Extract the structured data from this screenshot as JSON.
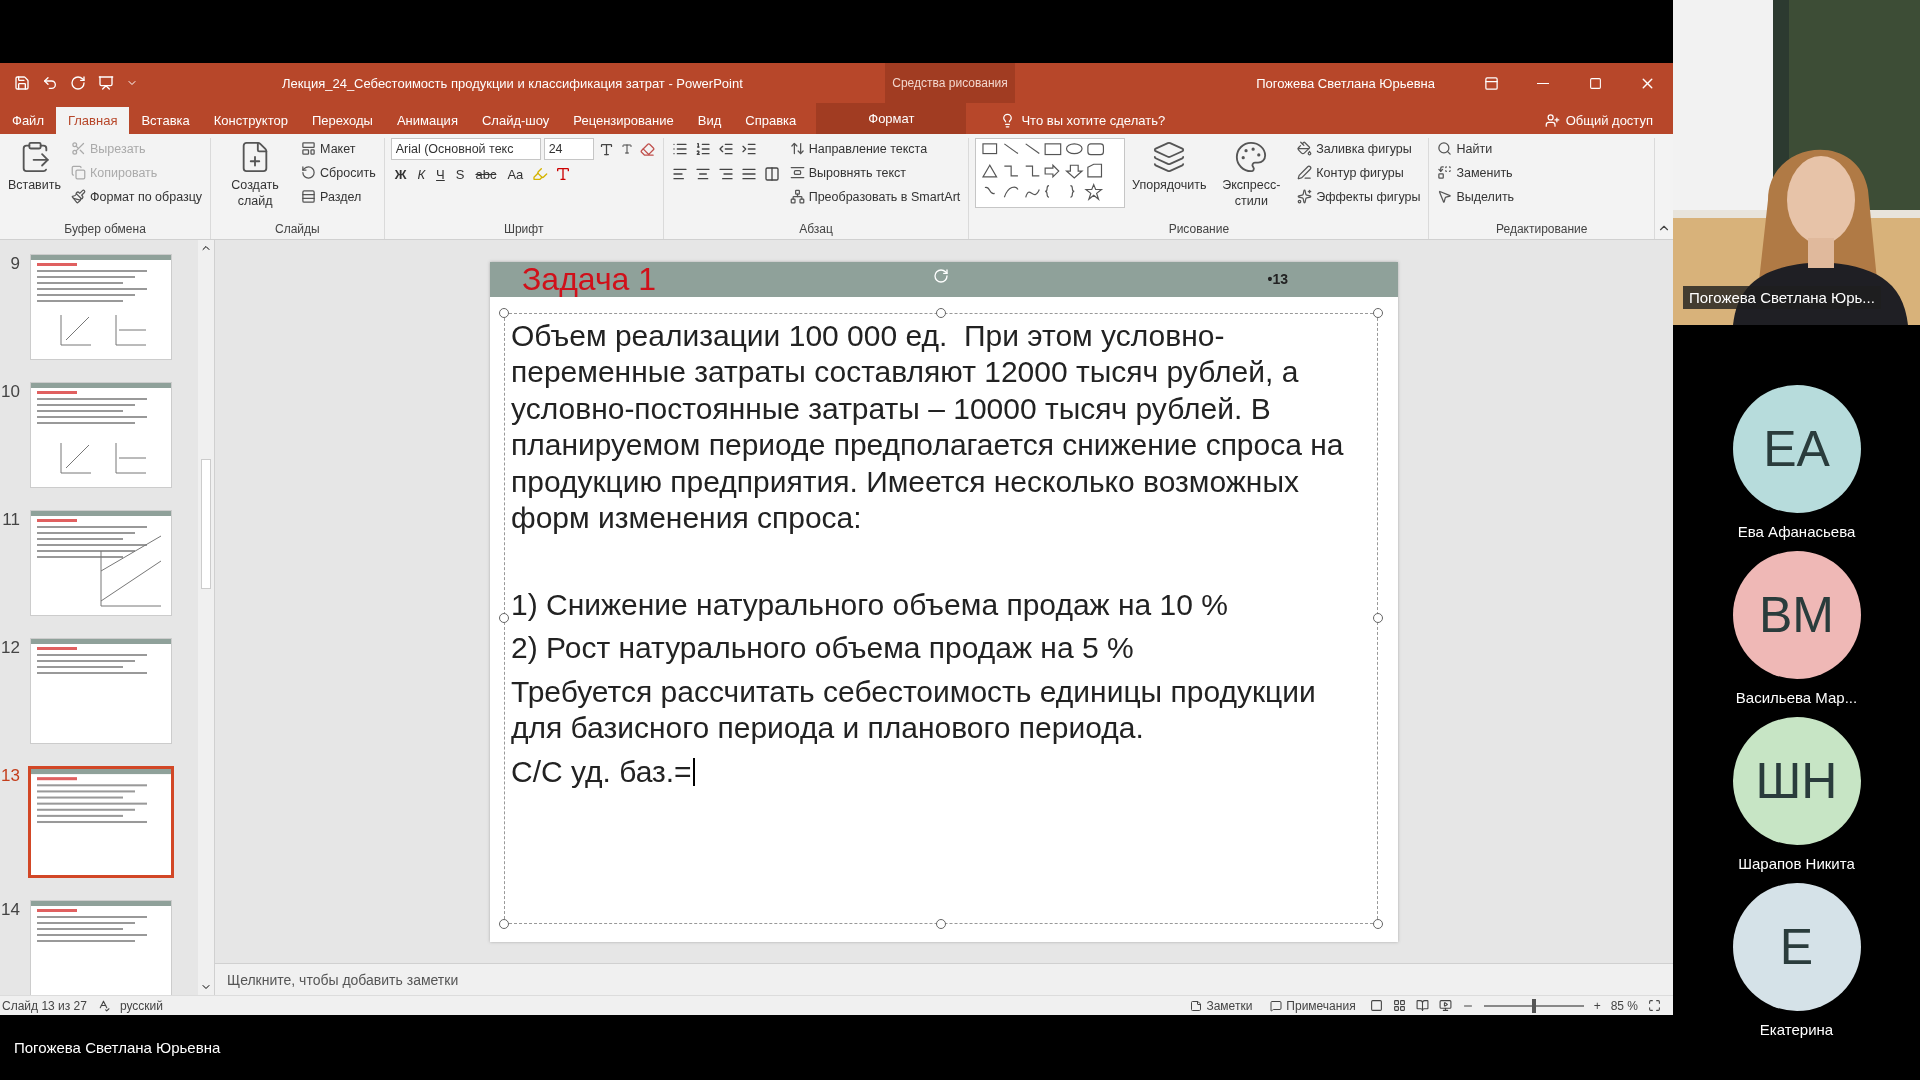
{
  "window": {
    "title": "Лекция_24_Себестоимость продукции и классификация затрат  -  PowerPoint",
    "context_group": "Средства рисования",
    "user": "Погожева Светлана Юрьевна"
  },
  "tabs": [
    {
      "label": "Файл",
      "selected": false,
      "kind": "file"
    },
    {
      "label": "Главная",
      "selected": true,
      "kind": "normal"
    },
    {
      "label": "Вставка",
      "selected": false,
      "kind": "normal"
    },
    {
      "label": "Конструктор",
      "selected": false,
      "kind": "normal"
    },
    {
      "label": "Переходы",
      "selected": false,
      "kind": "normal"
    },
    {
      "label": "Анимация",
      "selected": false,
      "kind": "normal"
    },
    {
      "label": "Слайд-шоу",
      "selected": false,
      "kind": "normal"
    },
    {
      "label": "Рецензирование",
      "selected": false,
      "kind": "normal"
    },
    {
      "label": "Вид",
      "selected": false,
      "kind": "normal"
    },
    {
      "label": "Справка",
      "selected": false,
      "kind": "normal"
    },
    {
      "label": "Формат",
      "selected": false,
      "kind": "contextual"
    }
  ],
  "tell_me": {
    "placeholder": "Что вы хотите сделать?"
  },
  "share": "Общий доступ",
  "ribbon": [
    {
      "kind": "clipboard",
      "label": "Буфер обмена",
      "items": [
        {
          "label": "Вставить",
          "kind": "large",
          "disabled": false
        },
        {
          "label": "Вырезать",
          "kind": "small",
          "disabled": true
        },
        {
          "label": "Копировать",
          "kind": "small",
          "disabled": true
        },
        {
          "label": "Формат по образцу",
          "kind": "small",
          "disabled": false
        }
      ]
    },
    {
      "kind": "slides",
      "label": "Слайды",
      "items": [
        {
          "label": "Создать слайд",
          "kind": "large",
          "disabled": false
        },
        {
          "label": "Макет",
          "kind": "small",
          "disabled": false
        },
        {
          "label": "Сбросить",
          "kind": "small",
          "disabled": false
        },
        {
          "label": "Раздел",
          "kind": "small",
          "disabled": false
        }
      ]
    },
    {
      "kind": "font",
      "label": "Шрифт",
      "font_name": "Arial (Основной текс",
      "font_size": "24",
      "buttons": [
        "Ж",
        "К",
        "Ч",
        "S",
        "abc",
        "Aa"
      ]
    },
    {
      "kind": "paragraph",
      "label": "Абзац",
      "items": [
        {
          "label": "Направление текста",
          "kind": "small",
          "disabled": false
        },
        {
          "label": "Выровнять текст",
          "kind": "small",
          "disabled": false
        },
        {
          "label": "Преобразовать в SmartArt",
          "kind": "small",
          "disabled": false
        }
      ]
    },
    {
      "kind": "drawing",
      "label": "Рисование",
      "items": [
        {
          "label": "Упорядочить",
          "kind": "large",
          "disabled": false
        },
        {
          "label": "Экспресс-стили",
          "kind": "large",
          "disabled": false
        },
        {
          "label": "Заливка фигуры",
          "kind": "small",
          "disabled": false
        },
        {
          "label": "Контур фигуры",
          "kind": "small",
          "disabled": false
        },
        {
          "label": "Эффекты фигуры",
          "kind": "small",
          "disabled": false
        }
      ]
    },
    {
      "kind": "editing",
      "label": "Редактирование",
      "items": [
        {
          "label": "Найти",
          "kind": "small",
          "disabled": false
        },
        {
          "label": "Заменить",
          "kind": "small",
          "disabled": false
        },
        {
          "label": "Выделить",
          "kind": "small",
          "disabled": false
        }
      ]
    }
  ],
  "thumbnails": [
    {
      "number": "9",
      "selected": false
    },
    {
      "number": "10",
      "selected": false
    },
    {
      "number": "11",
      "selected": false
    },
    {
      "number": "12",
      "selected": false
    },
    {
      "number": "13",
      "selected": true
    },
    {
      "number": "14",
      "selected": false
    }
  ],
  "slide": {
    "title": "Задача 1",
    "number": "•13",
    "paragraphs": [
      "Объем реализации 100 000 ед.  При этом условно-переменные затраты составляют 12000 тысяч рублей, а условно-постоянные затраты – 10000 тысяч рублей. В планируемом периоде предполагается снижение спроса на продукцию предприятия. Имеется несколько возможных форм изменения спроса:",
      "1) Снижение натурального объема продаж на 10 %",
      "2) Рост натурального объема продаж на 5 %",
      "Требуется рассчитать себестоимость единицы продукции для базисного периода и планового периода.",
      "С/С уд. баз.="
    ]
  },
  "notes": {
    "placeholder": "Щелкните, чтобы добавить заметки"
  },
  "status_bar": {
    "slide": "Слайд 13 из 27",
    "language": "русский",
    "notes": "Заметки",
    "comments": "Примечания",
    "zoom_in": "+",
    "zoom": "85 %",
    "level": 0.5
  },
  "video": {
    "caption": "Погожева Светлана Юрь..."
  },
  "participants": [
    {
      "initials": "ЕА",
      "name": "Ева Афанасьева",
      "color": "#b7dcdc"
    },
    {
      "initials": "ВМ",
      "name": "Васильева Мар...",
      "color": "#efb8b6"
    },
    {
      "initials": "ШН",
      "name": "Шарапов Никита",
      "color": "#c7e5c5"
    },
    {
      "initials": "Е",
      "name": "Екатерина",
      "color": "#d5e2e8"
    }
  ],
  "presenter": "Погожева Светлана Юрьевна"
}
